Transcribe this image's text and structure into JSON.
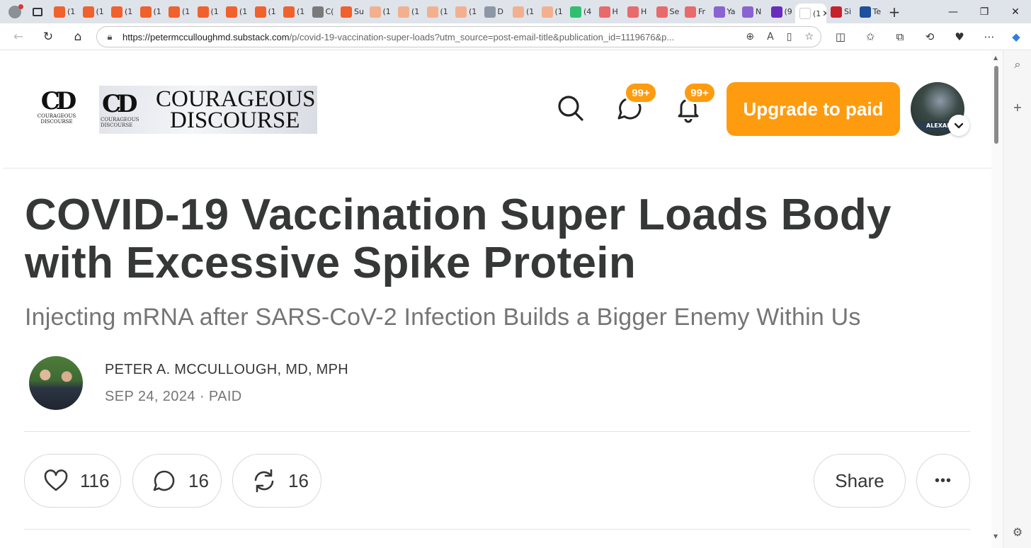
{
  "browser": {
    "tabs": [
      {
        "label": "(1",
        "color": "#f0612b"
      },
      {
        "label": "(1",
        "color": "#f0612b"
      },
      {
        "label": "(1",
        "color": "#f0612b"
      },
      {
        "label": "(1",
        "color": "#f0612b"
      },
      {
        "label": "(1",
        "color": "#f0612b"
      },
      {
        "label": "(1",
        "color": "#f0612b"
      },
      {
        "label": "(1",
        "color": "#f0612b"
      },
      {
        "label": "(1",
        "color": "#f0612b"
      },
      {
        "label": "(1",
        "color": "#f0612b"
      },
      {
        "label": "C(",
        "color": "#7a7a7a"
      },
      {
        "label": "Su",
        "color": "#f0612b"
      },
      {
        "label": "(1",
        "color": "#f2b08f"
      },
      {
        "label": "(1",
        "color": "#f2b08f"
      },
      {
        "label": "(1",
        "color": "#f2b08f"
      },
      {
        "label": "(1",
        "color": "#f2b08f"
      },
      {
        "label": "D",
        "color": "#8d97a6"
      },
      {
        "label": "(1",
        "color": "#f2b08f"
      },
      {
        "label": "(1",
        "color": "#f2b08f"
      },
      {
        "label": "(4",
        "color": "#2fbf71"
      },
      {
        "label": "H",
        "color": "#e86a6a"
      },
      {
        "label": "H",
        "color": "#e86a6a"
      },
      {
        "label": "Se",
        "color": "#e86a6a"
      },
      {
        "label": "Fr",
        "color": "#e86a6a"
      },
      {
        "label": "Ya",
        "color": "#8a63d2"
      },
      {
        "label": "N",
        "color": "#8a63d2"
      },
      {
        "label": "(9",
        "color": "#6a2bbf"
      }
    ],
    "active_tab": {
      "label": "(1",
      "close": "✕"
    },
    "tabs_after": [
      {
        "label": "Si",
        "color": "#c5222b"
      },
      {
        "label": "Te",
        "color": "#1d4f9c"
      }
    ],
    "new_tab": "+",
    "window_controls": {
      "minimize": "—",
      "restore": "❐",
      "close": "✕"
    },
    "url_host": "https://petermcculloughmd.substack.com",
    "url_path": "/p/covid-19-vaccination-super-loads?utm_source=post-email-title&publication_id=1119676&p...",
    "icons": [
      "back-icon",
      "refresh-icon",
      "home-icon",
      "lock-icon",
      "zoom-icon",
      "read-aloud-icon",
      "immersive-reader-icon",
      "favorite-icon",
      "split-screen-icon",
      "favorites-icon",
      "collections-icon",
      "history-icon",
      "extensions-icon",
      "more-icon",
      "copilot-icon",
      "sidebar-search-icon",
      "sidebar-add-icon",
      "sidebar-settings-icon"
    ]
  },
  "header": {
    "logo_mark": "CD",
    "logo_caption_1": "COURAGEOUS",
    "logo_caption_2": "DISCOURSE",
    "banner_line1": "COURAGEOUS",
    "banner_line2": "DISCOURSE",
    "chat_badge": "99+",
    "bell_badge": "99+",
    "upgrade_label": "Upgrade to paid",
    "avatar_band_text": "ALEXAND",
    "accent_color": "#ff9b0f"
  },
  "post": {
    "title": "COVID-19 Vaccination Super Loads Body with Excessive Spike Protein",
    "subtitle": "Injecting mRNA after SARS-CoV-2 Infection Builds a Bigger Enemy Within Us",
    "author": "PETER A. MCCULLOUGH, MD, MPH",
    "meta": "SEP 24, 2024 · PAID"
  },
  "actions": {
    "likes": "116",
    "comments": "16",
    "restacks": "16",
    "share_label": "Share",
    "more_label": "•••"
  }
}
